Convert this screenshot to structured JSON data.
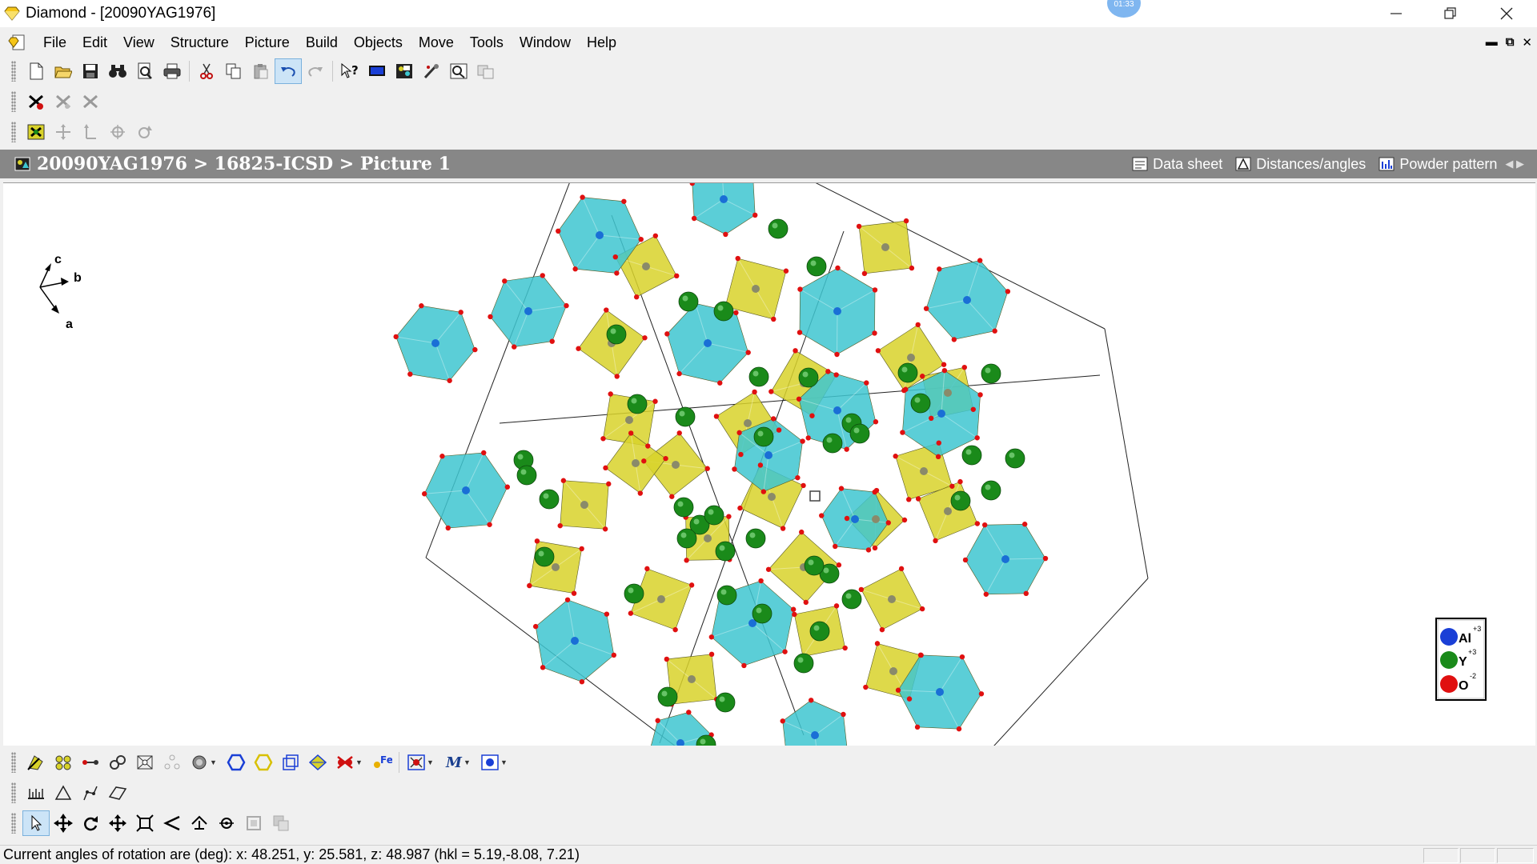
{
  "window": {
    "title": "Diamond - [20090YAG1976]",
    "clock_bubble": "01:33"
  },
  "menu": {
    "items": [
      "File",
      "Edit",
      "View",
      "Structure",
      "Picture",
      "Build",
      "Objects",
      "Move",
      "Tools",
      "Window",
      "Help"
    ]
  },
  "breadcrumb": {
    "path": "20090YAG1976 > 16825-ICSD > Picture 1"
  },
  "doc_tabs": {
    "data_sheet": "Data sheet",
    "distances": "Distances/angles",
    "powder": "Powder pattern"
  },
  "axes": {
    "c": "c",
    "b": "b",
    "a": "a"
  },
  "legend": {
    "entries": [
      {
        "element": "Al",
        "charge": "+3",
        "color": "#1a3fd6"
      },
      {
        "element": "Y",
        "charge": "+3",
        "color": "#1a8a1a"
      },
      {
        "element": "O",
        "charge": "-2",
        "color": "#e01010"
      }
    ]
  },
  "status": {
    "text": "Current angles of rotation are (deg): x: 48.251, y: 25.581, z: 48.987 (hkl =  5.19,-8.08, 7.21)"
  },
  "colors": {
    "octahedron": "#3ec6d0",
    "tetrahedron": "#d8d22a",
    "yttrium": "#1a8a1a",
    "oxygen": "#e01010",
    "aluminium": "#1a6fd6"
  }
}
